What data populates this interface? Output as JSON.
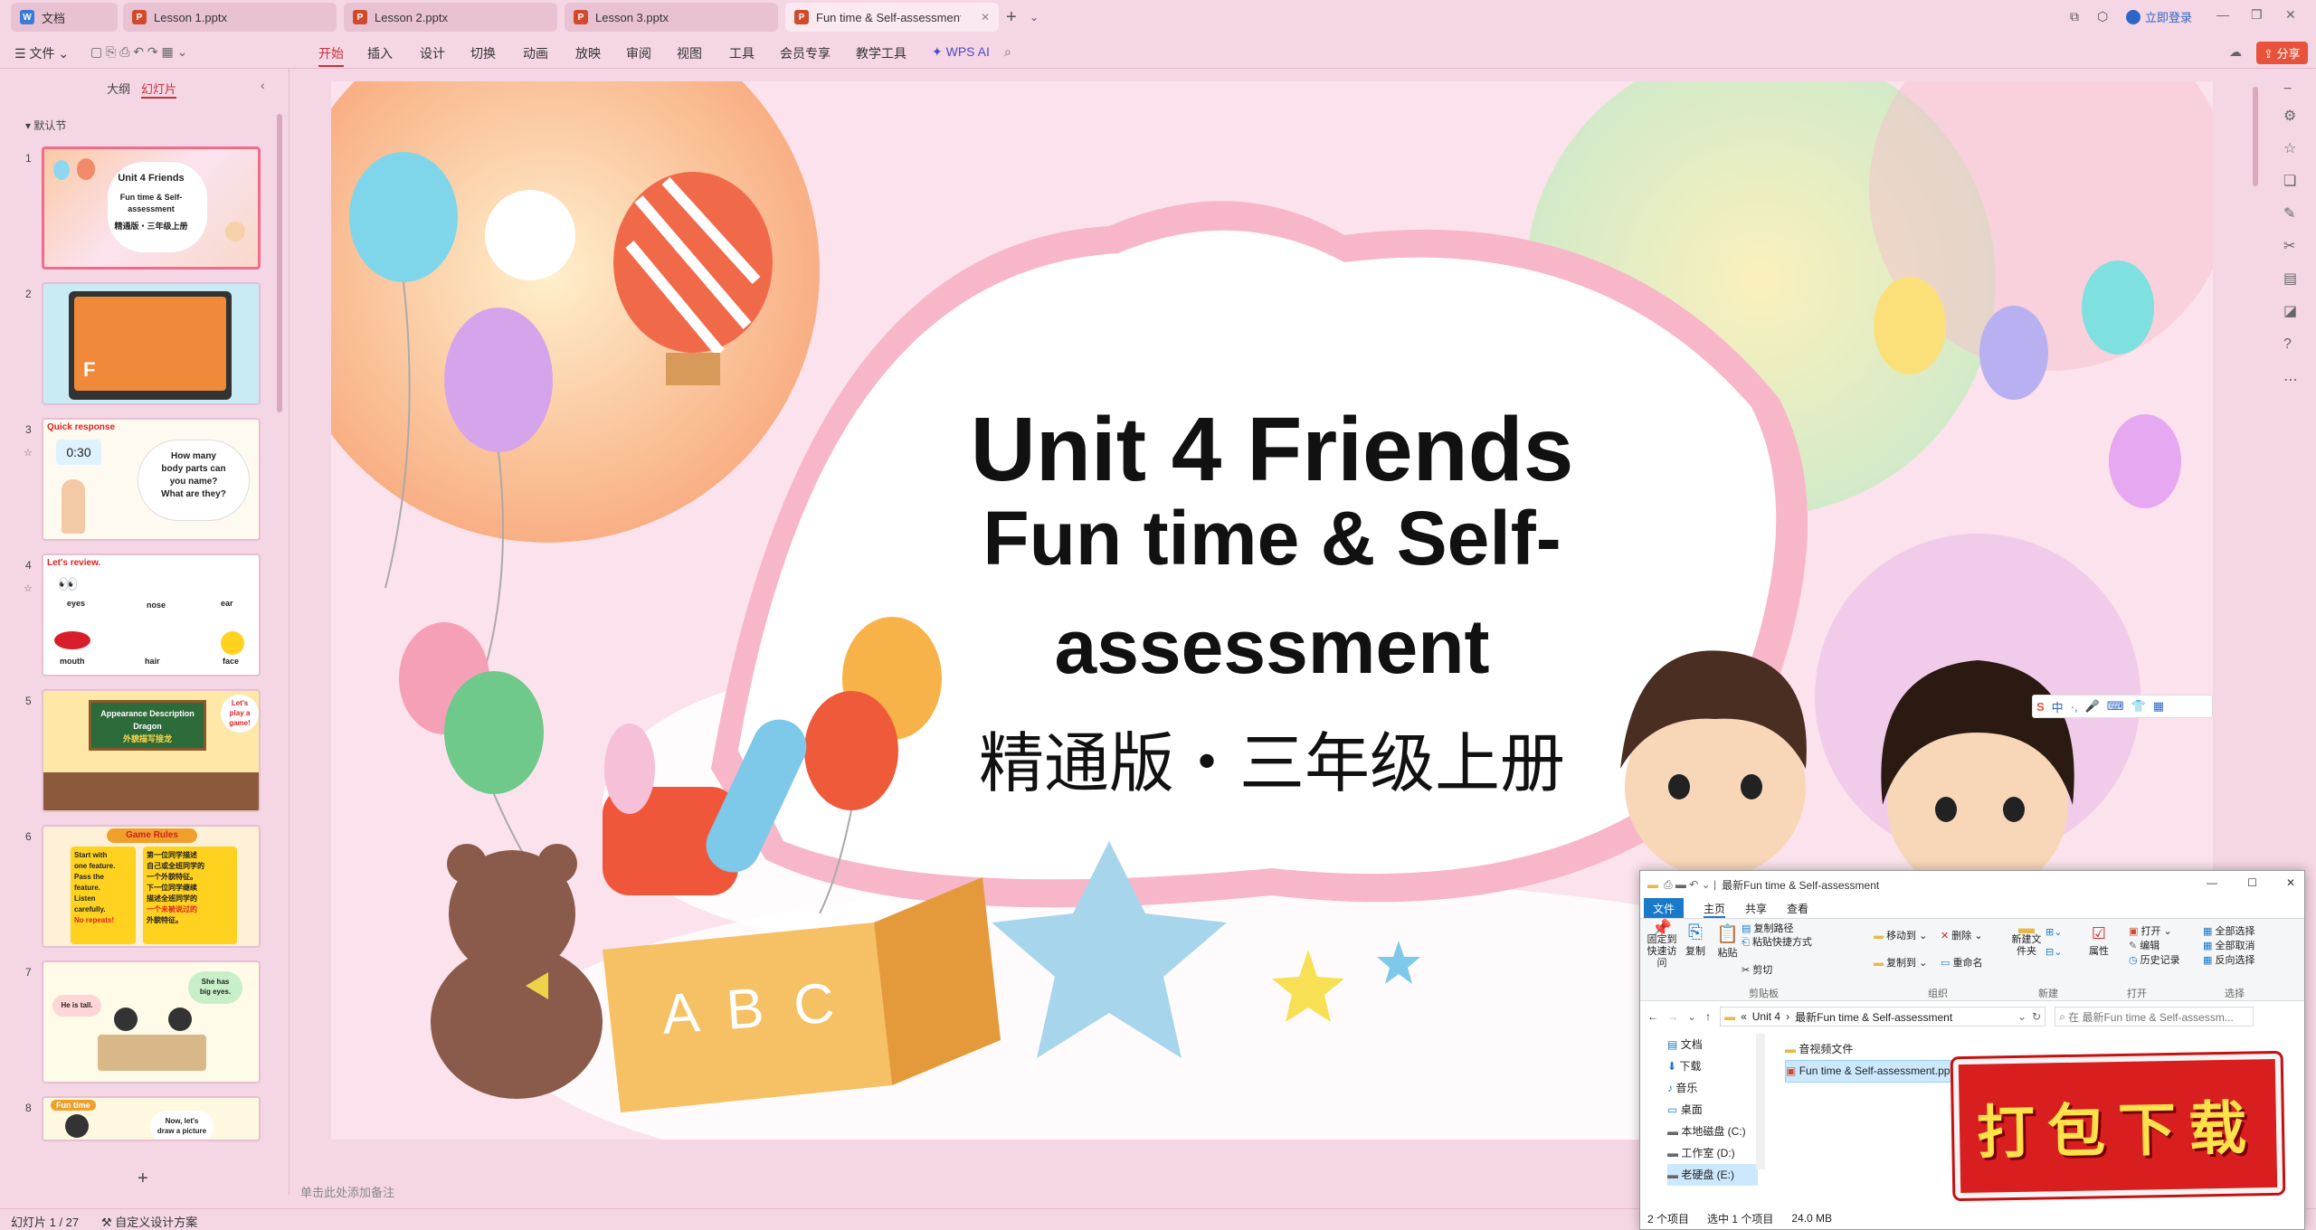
{
  "tabs": [
    {
      "label": "文档",
      "icon": "doc-icon",
      "color": "#3a7bd5"
    },
    {
      "label": "Lesson 1.pptx",
      "icon": "ppt-icon",
      "color": "#d04a2c"
    },
    {
      "label": "Lesson 2.pptx",
      "icon": "ppt-icon",
      "color": "#d04a2c"
    },
    {
      "label": "Lesson 3.pptx",
      "icon": "ppt-icon",
      "color": "#d04a2c"
    },
    {
      "label": "Fun time & Self-assessment",
      "icon": "ppt-icon",
      "color": "#d04a2c"
    }
  ],
  "titlebar": {
    "login": "立即登录",
    "share": "分享"
  },
  "ribbon": {
    "file": "文件",
    "items": [
      "开始",
      "插入",
      "设计",
      "切换",
      "动画",
      "放映",
      "审阅",
      "视图",
      "工具",
      "会员专享",
      "教学工具"
    ],
    "wps_ai": "WPS AI"
  },
  "leftpanel": {
    "tab_outline": "大纲",
    "tab_slides": "幻灯片",
    "section": "默认节"
  },
  "thumbs": [
    {
      "num": "1",
      "lines": [
        "Unit 4   Friends",
        "Fun time & Self-",
        "assessment",
        "精通版・三年级上册"
      ]
    },
    {
      "num": "2",
      "lines": [
        "F"
      ]
    },
    {
      "num": "3",
      "lines": [
        "Quick response",
        "0:30",
        "How many",
        "body parts can",
        "you name?",
        "What are they?"
      ]
    },
    {
      "num": "4",
      "lines": [
        "Let's review.",
        "eyes",
        "nose",
        "ear",
        "mouth",
        "hair",
        "face"
      ]
    },
    {
      "num": "5",
      "lines": [
        "Appearance Description",
        "Dragon",
        "外貌描写接龙",
        "Let's",
        "play a",
        "game!"
      ]
    },
    {
      "num": "6",
      "lines": [
        "Game Rules",
        "Start with",
        "one feature.",
        "Pass the",
        "feature.",
        "Listen",
        "carefully.",
        "No repeats!",
        "第一位同学描述",
        "自己或全班同学的",
        "一个外貌特征。",
        "下一位同学继续",
        "描述全班同学的",
        "一个未被说过的",
        "外貌特征。"
      ]
    },
    {
      "num": "7",
      "lines": [
        "He is tall.",
        "She has",
        "big eyes."
      ]
    },
    {
      "num": "8",
      "lines": [
        "Fun time",
        "Now, let's",
        "draw a picture"
      ]
    }
  ],
  "slide": {
    "title": "Unit 4   Friends",
    "subtitle1": "Fun time & Self-",
    "subtitle2": "assessment",
    "edition": "精通版・三年级上册",
    "box_text": "A B C"
  },
  "notes_placeholder": "单击此处添加备注",
  "status": {
    "slide_count": "幻灯片 1 / 27",
    "design": "自定义设计方案"
  },
  "ime": {
    "label": "中"
  },
  "explorer": {
    "title": "最新Fun time & Self-assessment",
    "tabs": [
      "文件",
      "主页",
      "共享",
      "查看"
    ],
    "ribbon": {
      "pin": "固定到快速访问",
      "copy": "复制",
      "paste": "粘贴",
      "copy_path": "复制路径",
      "paste_shortcut": "粘贴快捷方式",
      "cut": "剪切",
      "group_clipboard": "剪贴板",
      "move_to": "移动到",
      "copy_to": "复制到",
      "delete": "删除",
      "rename": "重命名",
      "group_organize": "组织",
      "new_folder": "新建文件夹",
      "group_new": "新建",
      "properties": "属性",
      "open": "打开",
      "edit": "编辑",
      "history": "历史记录",
      "group_open": "打开",
      "select_all": "全部选择",
      "select_none": "全部取消",
      "invert": "反向选择",
      "group_select": "选择"
    },
    "path": [
      "Unit 4",
      "最新Fun time & Self-assessment"
    ],
    "search_placeholder": "在 最新Fun time & Self-assessm...",
    "nav": [
      "文档",
      "下载",
      "音乐",
      "桌面",
      "本地磁盘 (C:)",
      "工作室 (D:)",
      "老硬盘 (E:)"
    ],
    "files": [
      "音视频文件",
      "Fun time & Self-assessment.pptx"
    ],
    "status": {
      "count": "2 个项目",
      "selected": "选中 1 个项目",
      "size": "24.0 MB"
    }
  },
  "banner": {
    "text": "打包下载"
  },
  "colors": {
    "accent": "#c7333a",
    "pink_bg": "#f4d6e4",
    "selected_thumb": "#f06c8a",
    "banner_red": "#d81e1e",
    "banner_text": "#ffe14a"
  }
}
